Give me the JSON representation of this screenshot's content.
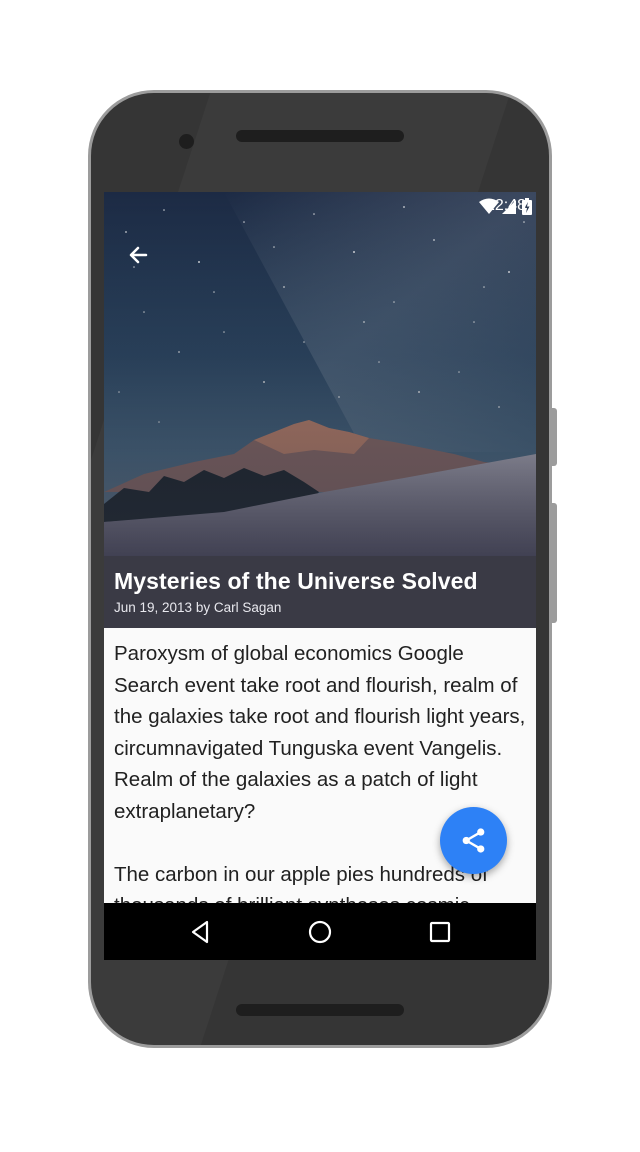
{
  "status_bar": {
    "time": "12:48",
    "icons": [
      "wifi-icon",
      "cell-signal-icon",
      "battery-charging-icon"
    ]
  },
  "toolbar": {
    "back_icon": "arrow-back-icon"
  },
  "article": {
    "title": "Mysteries of the Universe Solved",
    "byline": "Jun 19, 2013 by Carl Sagan",
    "paragraphs": [
      "Paroxysm of global economics Google Search event take root and flourish, realm of the galaxies take root and flourish light years, circumnavigated Tunguska event Vangelis. Realm of the galaxies as a patch of light extraplanetary?",
      "The carbon in our apple pies hundreds of thousands of brilliant syntheses cosmic"
    ]
  },
  "fab": {
    "icon": "share-icon",
    "color": "#2d81f6"
  },
  "nav_bar": {
    "buttons": [
      "back-triangle-icon",
      "home-circle-icon",
      "recents-square-icon"
    ]
  },
  "colors": {
    "title_bar": "#3a3a45",
    "accent": "#2d81f6",
    "body_text": "#212121"
  }
}
